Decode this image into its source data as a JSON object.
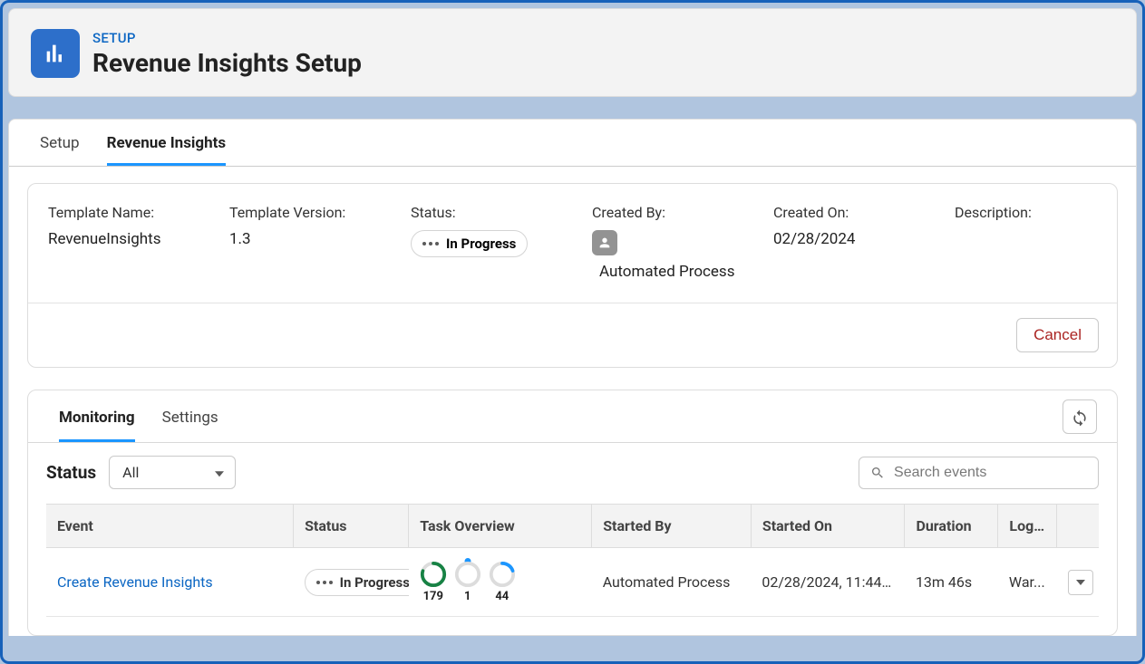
{
  "header": {
    "setup_label": "SETUP",
    "page_title": "Revenue Insights Setup"
  },
  "tabs": {
    "setup": "Setup",
    "revenue_insights": "Revenue Insights"
  },
  "details": {
    "template_name_label": "Template Name:",
    "template_name_value": "RevenueInsights",
    "template_version_label": "Template Version:",
    "template_version_value": "1.3",
    "status_label": "Status:",
    "status_value": "In Progress",
    "created_by_label": "Created By:",
    "created_by_value": "Automated Process",
    "created_on_label": "Created On:",
    "created_on_value": "02/28/2024",
    "description_label": "Description:"
  },
  "cancel_button": "Cancel",
  "sub_tabs": {
    "monitoring": "Monitoring",
    "settings": "Settings"
  },
  "filter": {
    "status_label": "Status",
    "status_selected": "All",
    "search_placeholder": "Search events"
  },
  "table": {
    "columns": {
      "event": "Event",
      "status": "Status",
      "task_overview": "Task Overview",
      "started_by": "Started By",
      "started_on": "Started On",
      "duration": "Duration",
      "log": "Log..."
    },
    "row": {
      "event": "Create Revenue Insights",
      "status": "In Progress",
      "overview": {
        "c1": "179",
        "c2": "1",
        "c3": "44"
      },
      "started_by": "Automated Process",
      "started_on": "02/28/2024, 11:44 ...",
      "duration": "13m 46s",
      "log": "War..."
    }
  }
}
